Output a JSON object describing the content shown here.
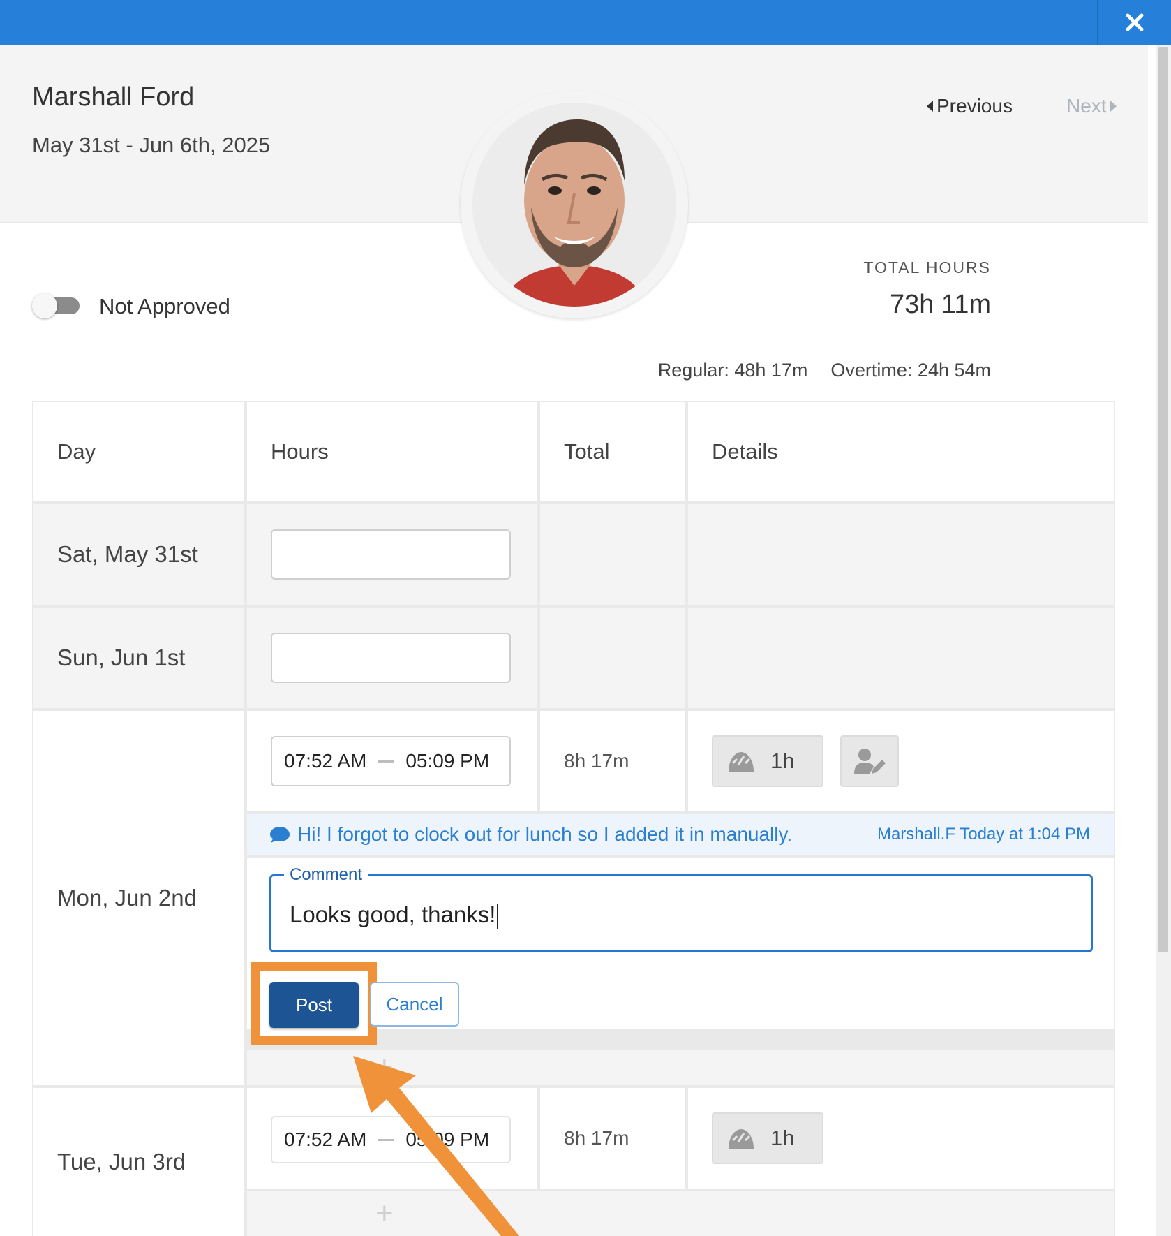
{
  "header": {
    "employee_name": "Marshall Ford",
    "period": "May 31st - Jun 6th, 2025",
    "previous_label": "Previous",
    "next_label": "Next"
  },
  "approval": {
    "label": "Not Approved",
    "approved": false
  },
  "totals": {
    "caption": "TOTAL HOURS",
    "value": "73h 11m",
    "regular": "Regular: 48h 17m",
    "overtime": "Overtime: 24h 54m"
  },
  "table": {
    "columns": [
      "Day",
      "Hours",
      "Total",
      "Details"
    ],
    "rows": [
      {
        "day": "Sat, May 31st"
      },
      {
        "day": "Sun, Jun 1st"
      },
      {
        "day": "Mon, Jun 2nd",
        "start": "07:52 AM",
        "end": "05:09 PM",
        "total": "8h 17m",
        "break": "1h"
      },
      {
        "day": "Tue, Jun 3rd",
        "start": "07:52 AM",
        "end": "05:09 PM",
        "total": "8h 17m",
        "break": "1h"
      }
    ]
  },
  "note": {
    "text": "Hi! I forgot to clock out for lunch so I added it in manually.",
    "meta": "Marshall.F Today at 1:04 PM"
  },
  "comment": {
    "legend": "Comment",
    "value": "Looks good, thanks!"
  },
  "actions": {
    "post_label": "Post",
    "cancel_label": "Cancel"
  },
  "colors": {
    "topbar": "#2680d9",
    "highlight": "#f0923a",
    "post": "#1d5494",
    "link": "#2a7fd1"
  },
  "icons": [
    "close-icon",
    "caret-left-icon",
    "caret-right-icon",
    "break-icon",
    "user-edit-icon",
    "comment-icon",
    "plus-icon"
  ]
}
